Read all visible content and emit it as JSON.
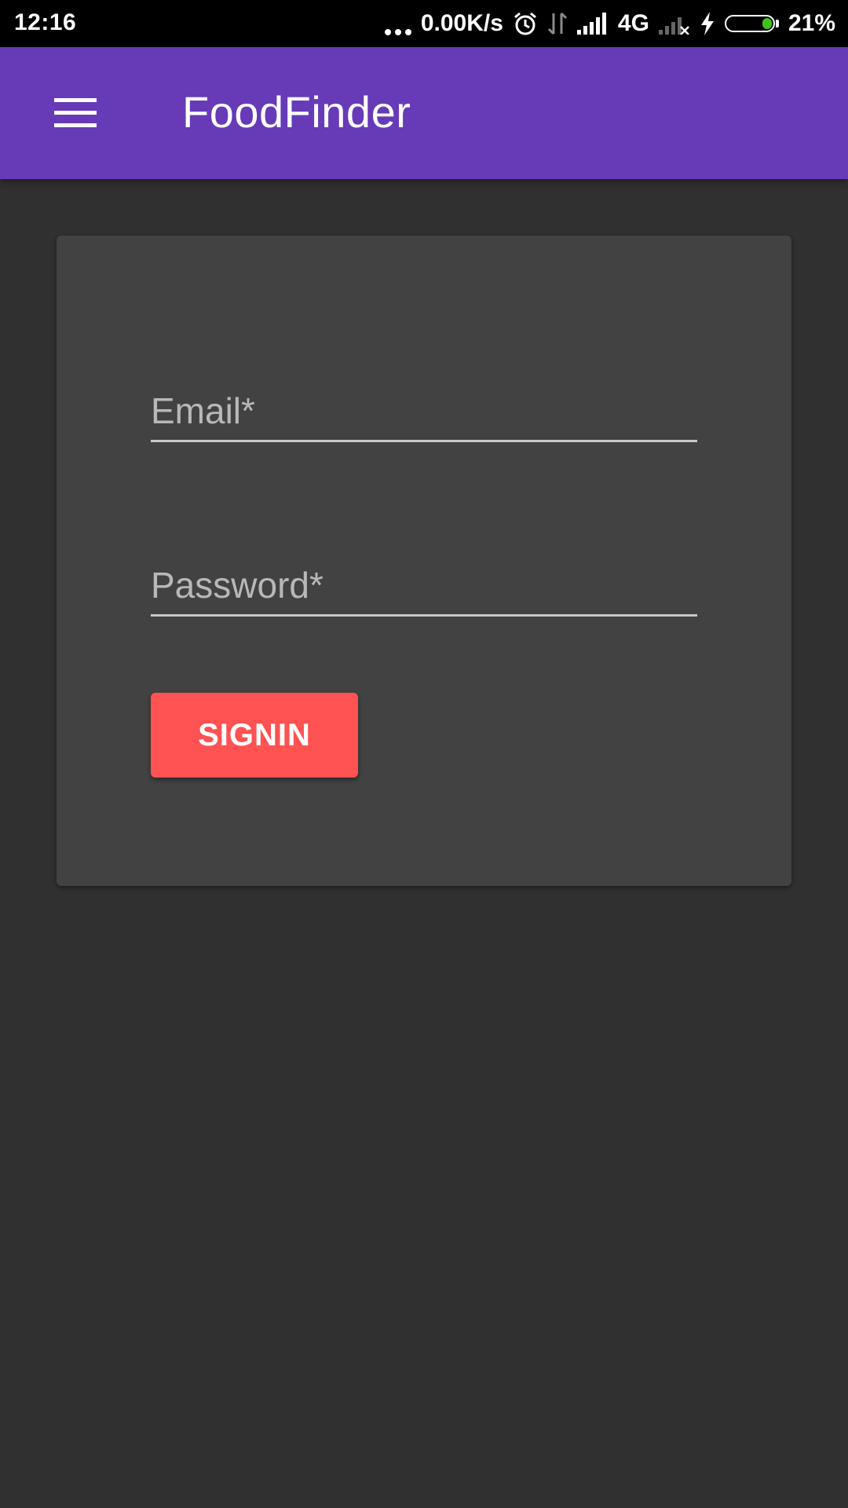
{
  "status_bar": {
    "time": "12:16",
    "network_speed": "0.00K/s",
    "network_type": "4G",
    "battery_percent": "21%",
    "battery_level": 0.21,
    "icons": [
      "more-dots-icon",
      "alarm-icon",
      "data-transfer-icon",
      "signal-icon",
      "no-signal-icon",
      "charging-icon",
      "battery-icon"
    ]
  },
  "app_bar": {
    "title": "FoodFinder",
    "menu_icon": "hamburger-menu-icon",
    "background_color": "#673ab7"
  },
  "login_form": {
    "email_placeholder": "Email*",
    "email_value": "",
    "password_placeholder": "Password*",
    "password_value": "",
    "signin_label": "SIGNIN",
    "signin_color": "#ff5252"
  }
}
